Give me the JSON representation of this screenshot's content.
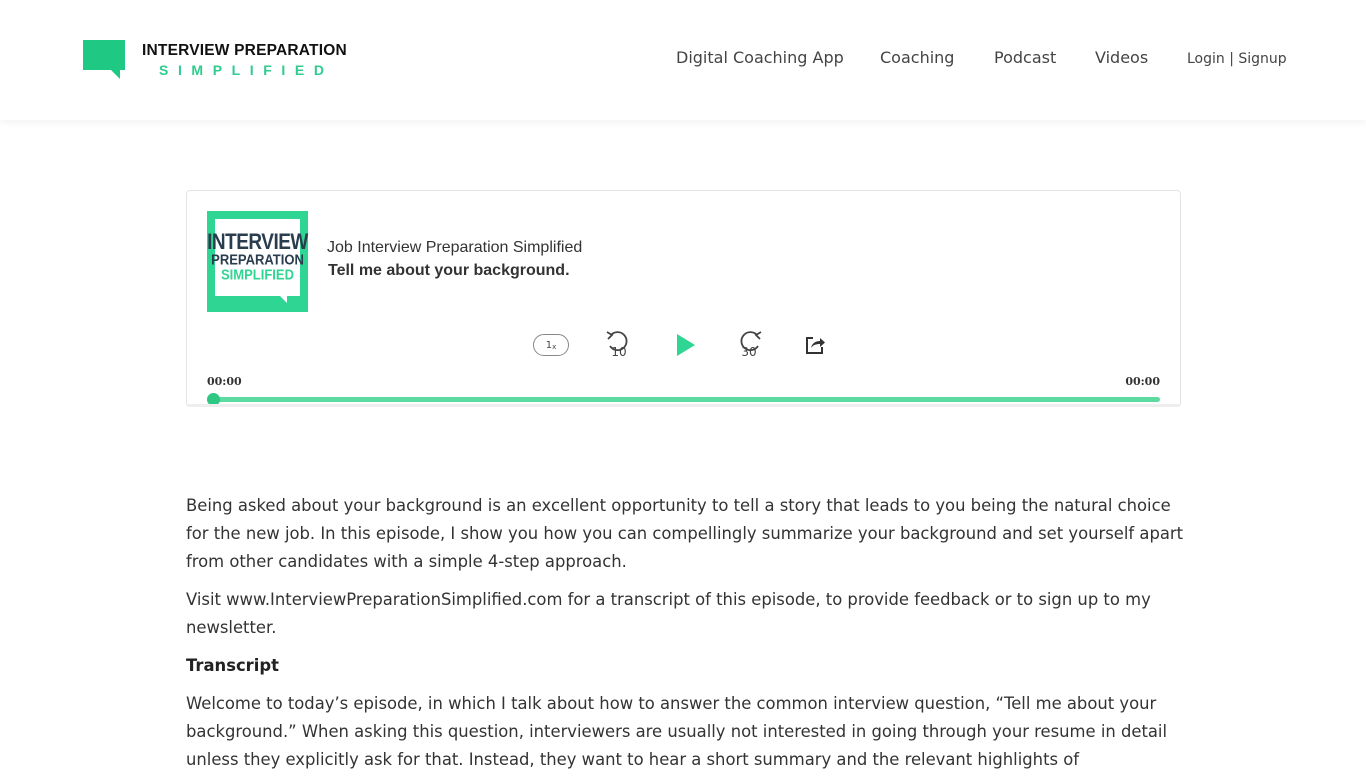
{
  "header": {
    "logo": {
      "line1": "INTERVIEW PREPARATION",
      "line2": "SIMPLIFIED",
      "icon": "speech-bubble-icon",
      "brand_color": "#1fc883"
    },
    "nav": [
      {
        "label": "Digital Coaching App"
      },
      {
        "label": "Coaching"
      },
      {
        "label": "Podcast"
      },
      {
        "label": "Videos"
      },
      {
        "label": "Login | Signup"
      }
    ]
  },
  "player": {
    "cover": {
      "line1": "INTERVIEW",
      "line2": "PREPARATION",
      "line3": "SIMPLIFIED"
    },
    "show_name": "Job Interview Preparation Simplified",
    "episode_title": "Tell me about your background.",
    "controls": {
      "speed": "1",
      "speed_suffix": "x",
      "rewind_seconds": "10",
      "forward_seconds": "30",
      "rewind_icon": "rewind-10-icon",
      "play_icon": "play-icon",
      "forward_icon": "forward-30-icon",
      "share_icon": "share-icon"
    },
    "time_elapsed": "00:00",
    "time_total": "00:00",
    "progress": 0,
    "accent_color": "#2fd592"
  },
  "content": {
    "paragraphs": [
      "Being asked about your background is an excellent opportunity to tell a story that leads to you being the natural choice for the new job. In this episode, I show you how you can compellingly summarize your background and set yourself apart from other candidates with a simple 4-step approach.",
      "Visit www.InterviewPreparationSimplified.com for a transcript of this episode, to provide feedback or to sign up to my newsletter."
    ],
    "transcript_heading": "Transcript",
    "transcript_paragraph": "Welcome to today’s episode, in which I talk about how to answer the common interview question, “Tell me about your background.” When asking this question, interviewers are usually not interested in going through your resume in detail unless they explicitly ask for that. Instead, they want to hear a short summary and the relevant highlights of"
  }
}
